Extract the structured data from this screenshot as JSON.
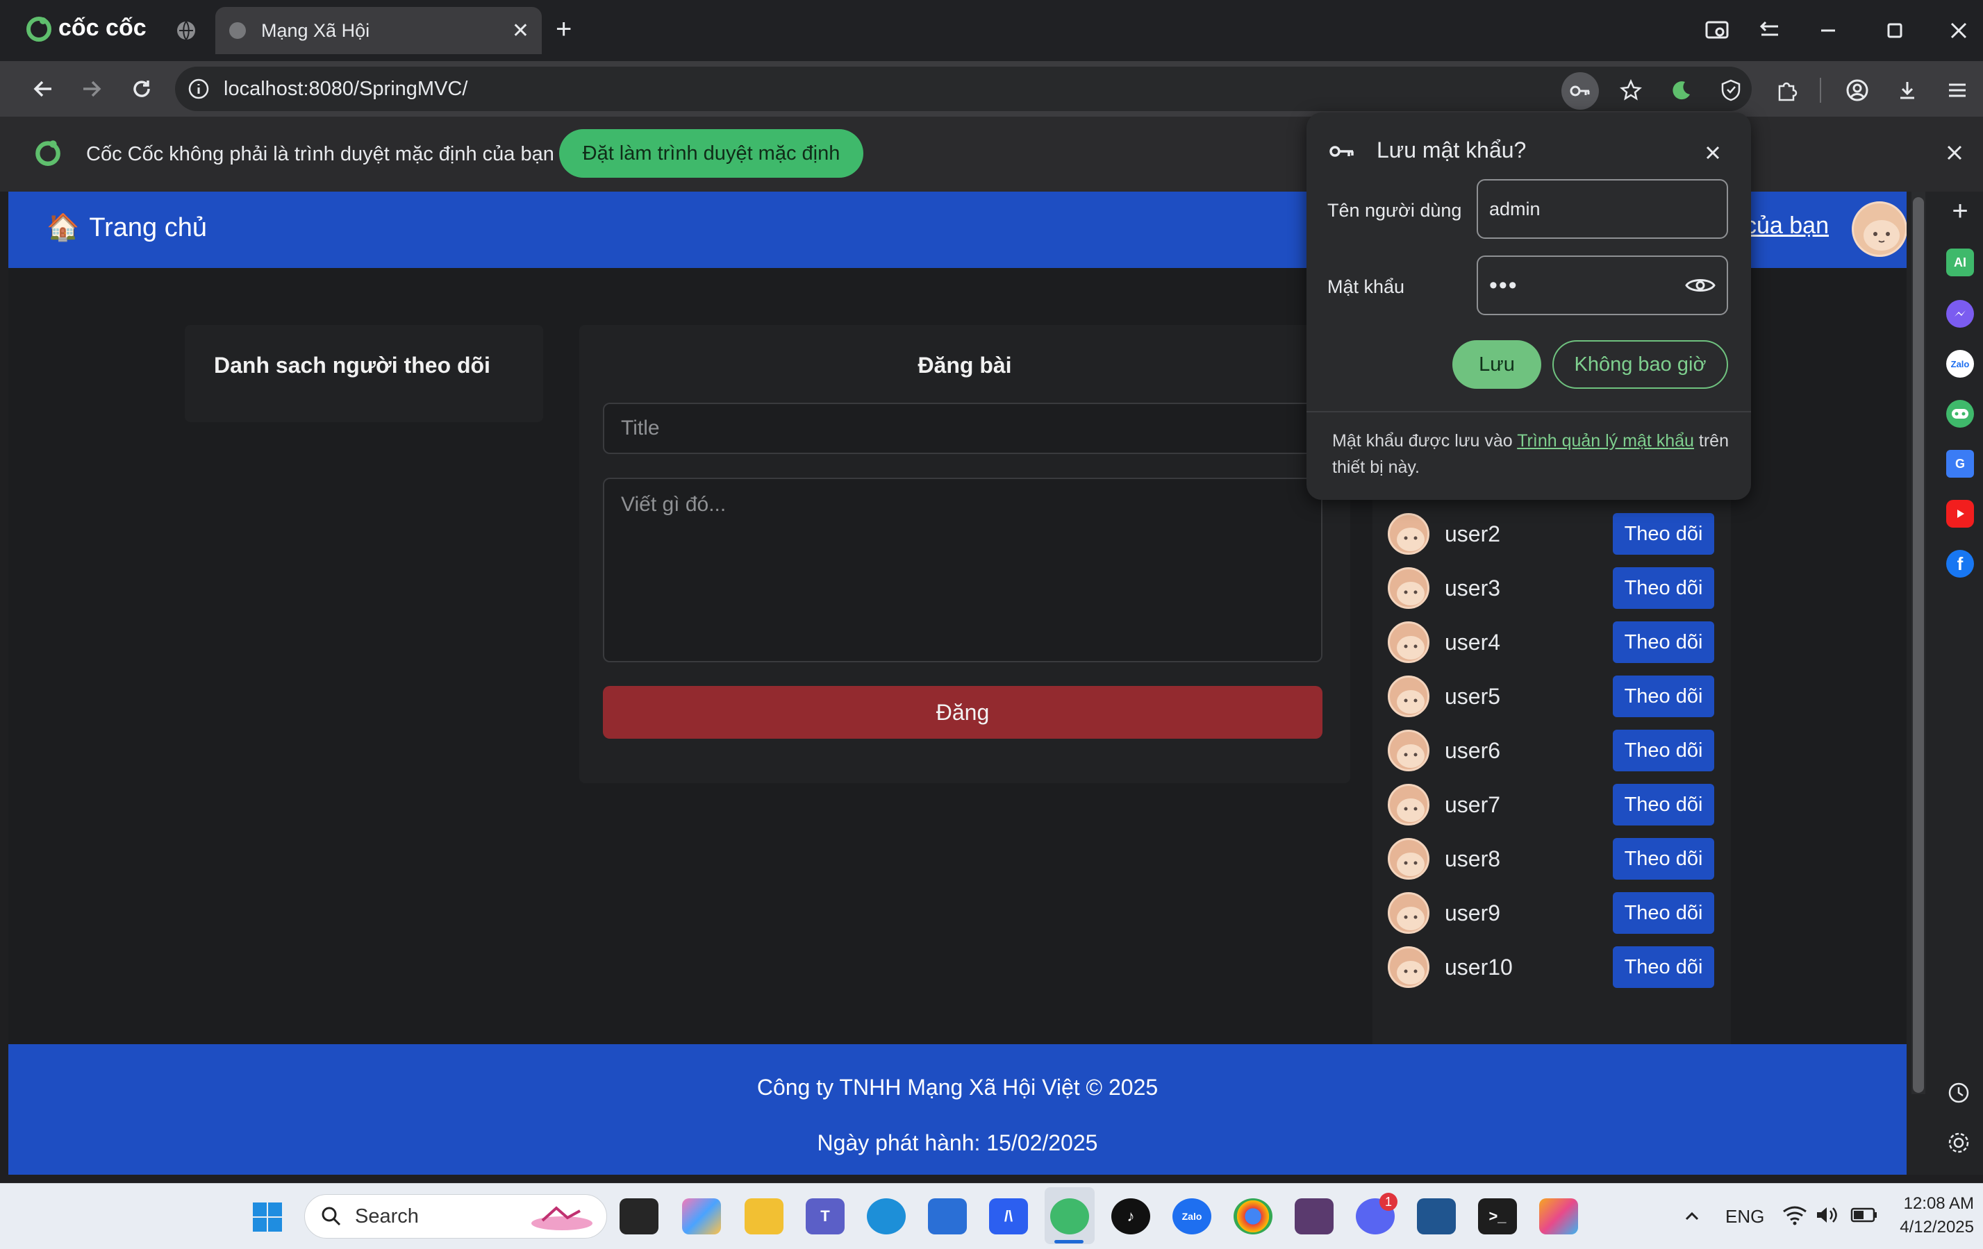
{
  "browser": {
    "brand": "cốc cốc",
    "tab": {
      "title": "Mạng Xã Hội"
    },
    "url": "localhost:8080/SpringMVC/",
    "infobar": {
      "message": "Cốc Cốc không phải là trình duyệt mặc định của bạn",
      "button": "Đặt làm trình duyệt mặc định"
    }
  },
  "site": {
    "nav": {
      "home_icon": "🏠",
      "home": "Trang chủ",
      "profile_link": "của bạn"
    },
    "followers": {
      "title": "Danh sach người theo dõi"
    },
    "post": {
      "title": "Đăng bài",
      "title_placeholder": "Title",
      "content_placeholder": "Viết gì đó...",
      "submit": "Đăng"
    },
    "suggestions": [
      {
        "name": "user2",
        "action": "Theo dõi"
      },
      {
        "name": "user3",
        "action": "Theo dõi"
      },
      {
        "name": "user4",
        "action": "Theo dõi"
      },
      {
        "name": "user5",
        "action": "Theo dõi"
      },
      {
        "name": "user6",
        "action": "Theo dõi"
      },
      {
        "name": "user7",
        "action": "Theo dõi"
      },
      {
        "name": "user8",
        "action": "Theo dõi"
      },
      {
        "name": "user9",
        "action": "Theo dõi"
      },
      {
        "name": "user10",
        "action": "Theo dõi"
      }
    ],
    "footer": {
      "company": "Công ty TNHH Mạng Xã Hội Việt © 2025",
      "release": "Ngày phát hành: 15/02/2025"
    }
  },
  "password_popup": {
    "title": "Lưu mật khẩu?",
    "username_label": "Tên người dùng",
    "username_value": "admin",
    "password_label": "Mật khẩu",
    "password_value": "•••",
    "save": "Lưu",
    "never": "Không bao giờ",
    "note_prefix": "Mật khẩu được lưu vào ",
    "note_link": "Trình quản lý mật khẩu",
    "note_suffix": " trên thiết bị này."
  },
  "sidebar_icons": [
    "plus-icon",
    "ai-icon",
    "messenger-icon",
    "zalo-icon",
    "game-icon",
    "translate-icon",
    "youtube-icon",
    "facebook-icon",
    "history-icon",
    "settings-icon"
  ],
  "taskbar": {
    "search": "Search",
    "lang": "ENG",
    "time": "12:08 AM",
    "date": "4/12/2025",
    "discord_badge": "1",
    "zalo_label": "Zalo"
  },
  "colors": {
    "nav_blue": "#1e4ec2",
    "submit_red": "#932a2f",
    "accent_green": "#6fc27f"
  }
}
